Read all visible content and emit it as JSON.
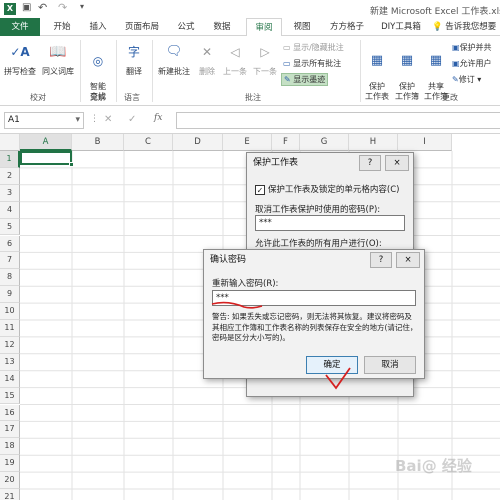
{
  "window": {
    "title": "新建 Microsoft Excel 工作表.xlsx"
  },
  "tabs": {
    "file": "文件",
    "items": [
      "开始",
      "插入",
      "页面布局",
      "公式",
      "数据",
      "审阅",
      "视图",
      "方方格子",
      "DIY工具箱"
    ],
    "active": "审阅",
    "tellme": "告诉我您想要"
  },
  "ribbon": {
    "proof": {
      "spell": "拼写检查",
      "thesaurus": "同义词库",
      "group": "校对"
    },
    "insights": {
      "smart": "智能\n查找",
      "group": "见解"
    },
    "language": {
      "translate": "翻译",
      "group": "语言"
    },
    "comments": {
      "new": "新建批注",
      "delete": "删除",
      "prev": "上一条",
      "next": "下一条",
      "show_hide": "显示/隐藏批注",
      "show_all": "显示所有批注",
      "show_ink": "显示墨迹",
      "group": "批注"
    },
    "changes": {
      "protect_sheet": "保护\n工作表",
      "protect_wb": "保护\n工作簿",
      "share_wb": "共享\n工作簿",
      "protect_share": "保护并共",
      "allow_users": "允许用户",
      "track": "修订",
      "group": "更改"
    }
  },
  "formula_bar": {
    "name_box": "A1",
    "fx": "fx"
  },
  "columns": [
    "A",
    "B",
    "C",
    "D",
    "E",
    "F",
    "G",
    "H",
    "I"
  ],
  "rows": [
    "1",
    "2",
    "3",
    "4",
    "5",
    "6",
    "7",
    "8",
    "9",
    "10",
    "11",
    "12",
    "13",
    "14",
    "15",
    "16",
    "17",
    "18",
    "19",
    "20",
    "21"
  ],
  "protect_dialog": {
    "title": "保护工作表",
    "help": "?",
    "close": "×",
    "checkbox_label": "保护工作表及锁定的单元格内容(C)",
    "checkbox_checked": true,
    "password_label": "取消工作表保护时使用的密码(P):",
    "password_value": "***",
    "allow_label": "允许此工作表的所有用户进行(O):"
  },
  "confirm_dialog": {
    "title": "确认密码",
    "help": "?",
    "close": "×",
    "reenter_label": "重新输入密码(R):",
    "password_value": "***",
    "warning": "警告: 如果丢失或忘记密码，则无法将其恢复。建议将密码及其相应工作簿和工作表名称的列表保存在安全的地方(请记住，密码是区分大小写的)。",
    "ok": "确定",
    "cancel": "取消"
  },
  "watermark": "Bai@ 经验",
  "colors": {
    "excel_green": "#217346",
    "annotation_red": "#d42020",
    "selection": "#cce8ff"
  }
}
